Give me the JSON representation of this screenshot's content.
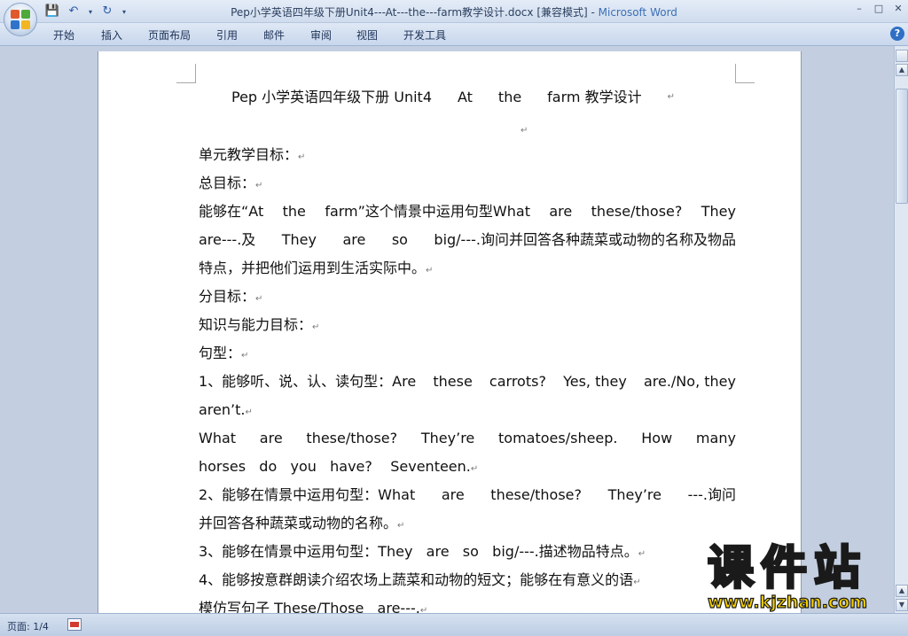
{
  "window": {
    "title_doc": "Pep小学英语四年级下册Unit4---At---the---farm教学设计.docx [兼容模式] - ",
    "title_app": "Microsoft Word",
    "controls": [
      "–",
      "□",
      "✕"
    ]
  },
  "qat": {
    "save": "💾",
    "undo": "↶",
    "redo": "↻",
    "more": "▾"
  },
  "ribbon": {
    "tabs": [
      "开始",
      "插入",
      "页面布局",
      "引用",
      "邮件",
      "审阅",
      "视图",
      "开发工具"
    ],
    "help": "?"
  },
  "document": {
    "pilcrow": "↵",
    "title_words": [
      "Pep 小学英语四年级下册 Unit4",
      "At",
      "the",
      "farm 教学设计"
    ],
    "lines": [
      {
        "text": "单元教学目标：",
        "words": null
      },
      {
        "text": "总目标：",
        "words": null
      },
      {
        "text": null,
        "words": [
          "能够在“At",
          "the",
          "farm”这个情景中运用句型What",
          "are",
          "these/those?",
          "They"
        ]
      },
      {
        "text": null,
        "words": [
          "are---.及",
          "They",
          "are",
          "so",
          "big/---.询问并回答各种蔬菜或动物的名称及物品"
        ]
      },
      {
        "text": "特点，并把他们运用到生活实际中。",
        "words": null
      },
      {
        "text": "分目标：",
        "words": null
      },
      {
        "text": "知识与能力目标：",
        "words": null
      },
      {
        "text": "句型：",
        "words": null
      },
      {
        "text": null,
        "words": [
          "1、能够听、说、认、读句型：Are",
          "these",
          "carrots?",
          "Yes, they",
          "are./No, they"
        ]
      },
      {
        "text": "aren’t.",
        "words": null
      },
      {
        "text": null,
        "words": [
          "What",
          "are",
          "these/those?",
          "They’re",
          "tomatoes/sheep.",
          "How",
          "many"
        ]
      },
      {
        "text": "horses   do   you   have?    Seventeen.",
        "words": null
      },
      {
        "text": null,
        "words": [
          "2、能够在情景中运用句型：What",
          "are",
          "these/those?",
          "They’re",
          "---.询问"
        ]
      },
      {
        "text": "并回答各种蔬菜或动物的名称。",
        "words": null
      },
      {
        "text": "3、能够在情景中运用句型：They   are   so   big/---.描述物品特点。",
        "words": null
      },
      {
        "text": "4、能够按意群朗读介绍农场上蔬菜和动物的短文；能够在有意义的语",
        "words": null
      },
      {
        "text": "模仿写句子 These/Those   are---.",
        "words": null
      }
    ]
  },
  "status": {
    "page": "页面: 1/4"
  },
  "watermark": {
    "cn": "课件站",
    "url": "www.kjzhan.com"
  },
  "colors": {
    "accent": "#3b6fb6",
    "watermark_fill": "#f5d000"
  }
}
